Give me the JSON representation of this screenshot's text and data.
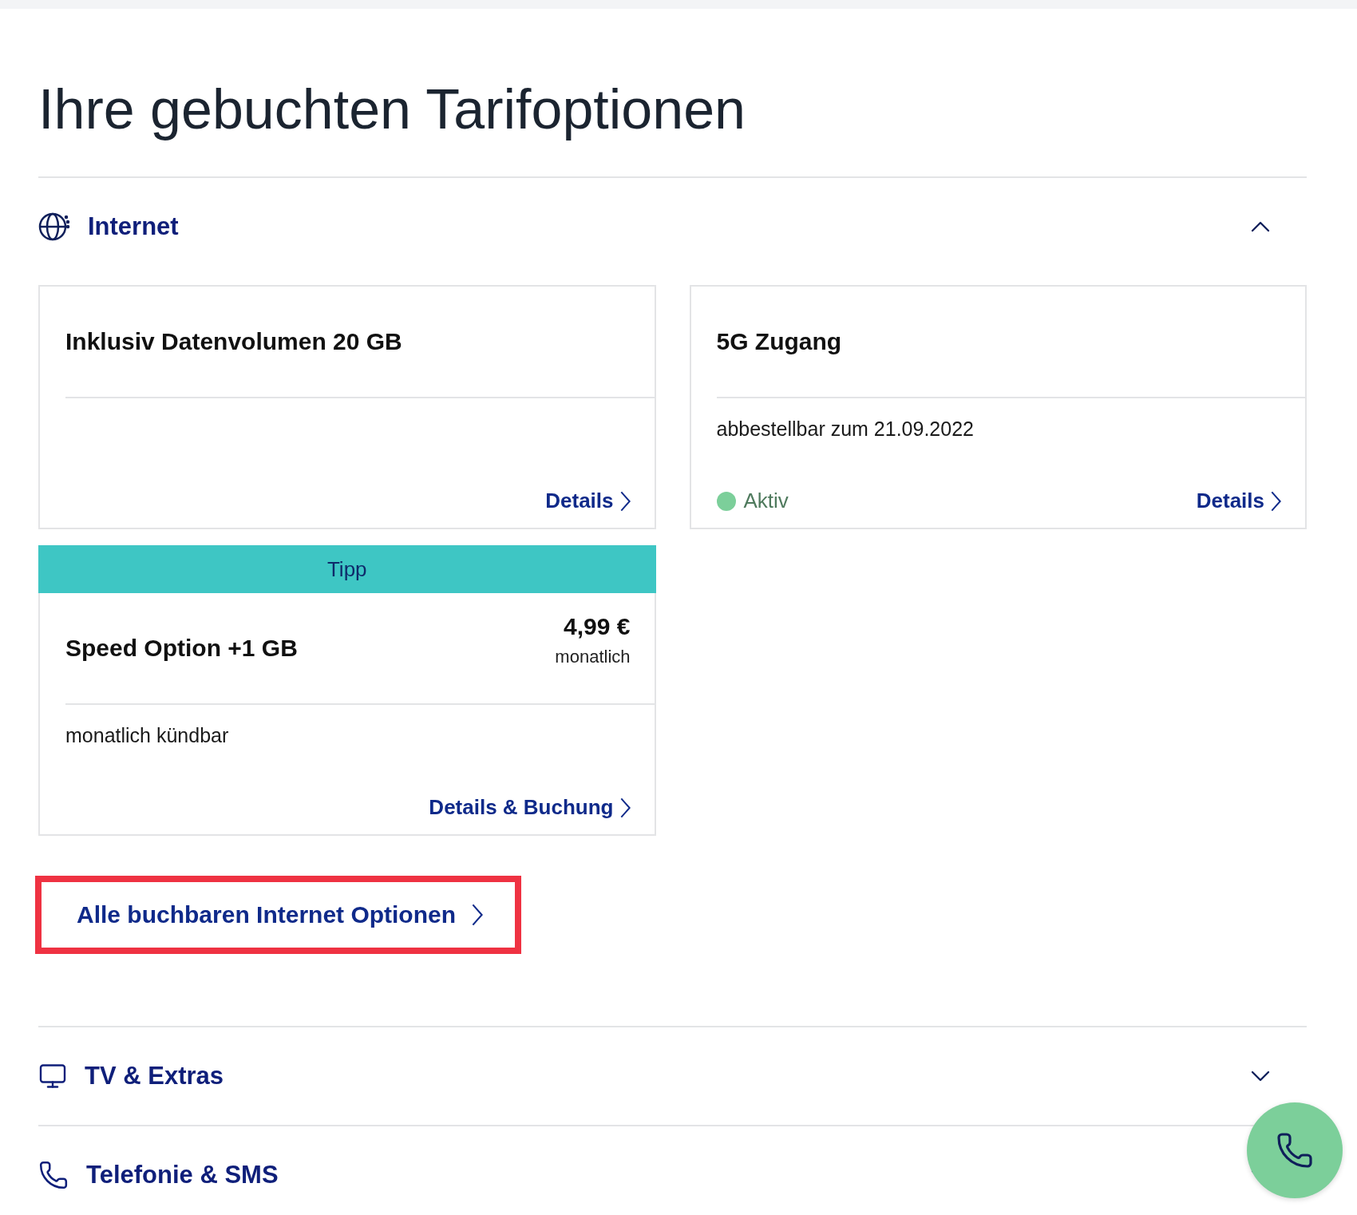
{
  "title": "Ihre gebuchten Tarifoptionen",
  "sections": [
    {
      "kind": "internet",
      "label": "Internet",
      "expanded": true,
      "cards": [
        {
          "title": "Inklusiv Datenvolumen 20 GB",
          "link": "Details"
        },
        {
          "title": "5G Zugang",
          "note": "abbestellbar zum 21.09.2022",
          "status": {
            "label": "Aktiv",
            "color": "#7ccf9a"
          },
          "link": "Details"
        },
        {
          "tag": "Tipp",
          "title": "Speed Option +1 GB",
          "price": "4,99 €",
          "price_period": "monatlich",
          "note": "monatlich kündbar",
          "link": "Details & Buchung"
        }
      ],
      "all_options_link": "Alle buchbaren Internet Optionen"
    },
    {
      "kind": "tv",
      "label": "TV & Extras",
      "expanded": false
    },
    {
      "kind": "phone",
      "label": "Telefonie & SMS",
      "expanded": false
    }
  ]
}
